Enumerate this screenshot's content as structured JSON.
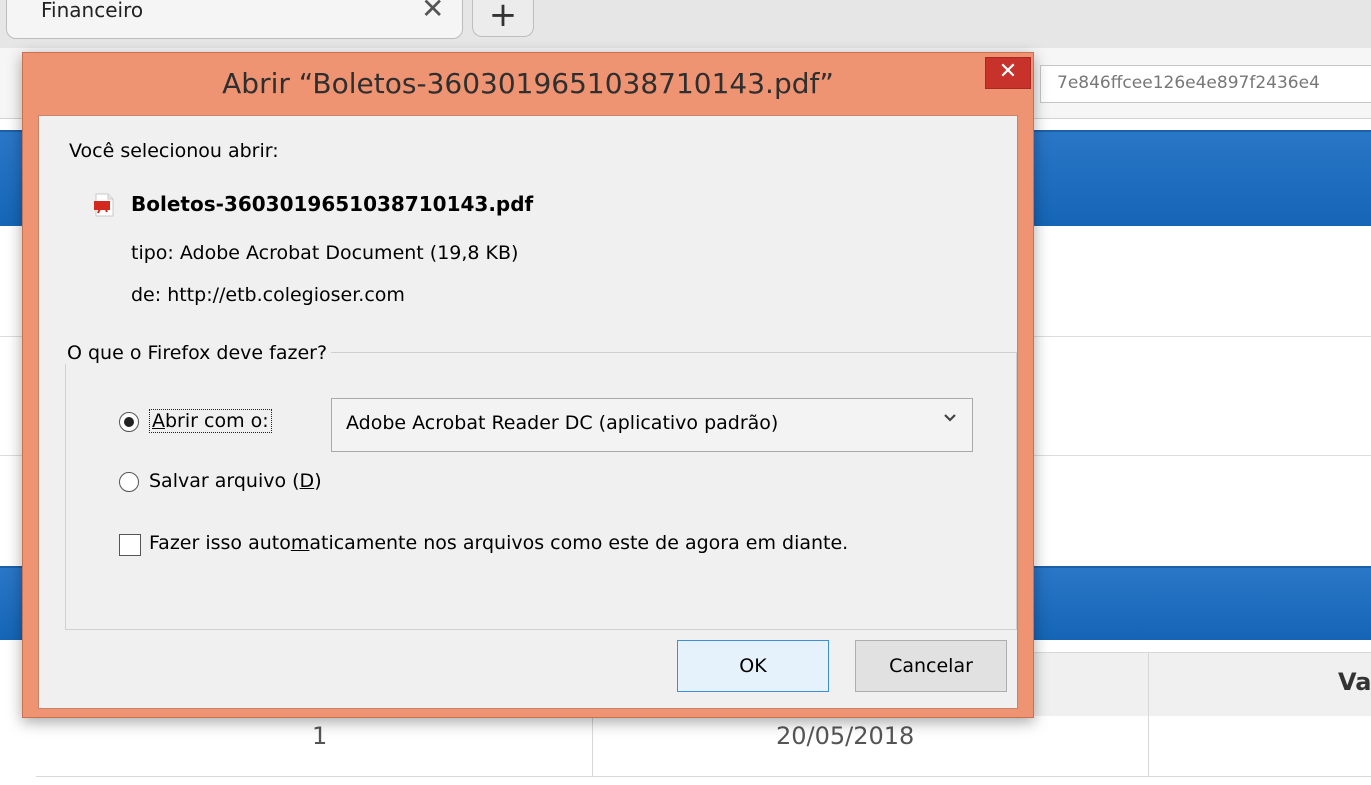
{
  "browser": {
    "tab_title": "Financeiro",
    "tab_close": "✕",
    "new_tab": "+",
    "url_fragment": "7e846ffcee126e4e897f2436e4",
    "table": {
      "header_partial": "Va",
      "row1_col1": "1",
      "row1_col2": "20/05/2018"
    }
  },
  "dialog": {
    "title": "Abrir “Boletos-3603019651038710143.pdf”",
    "close_label": "✕",
    "intro": "Você selecionou abrir:",
    "file_name": "Boletos-3603019651038710143.pdf",
    "type_line": "tipo:  Adobe Acrobat Document (19,8 KB)",
    "from_line": "de:  http://etb.colegioser.com",
    "group_label": "O que o Firefox deve fazer?",
    "open_with_prefix": "A",
    "open_with_rest": "brir com o:",
    "open_with_selected": "Adobe Acrobat Reader DC  (aplicativo padrão)",
    "save_prefix": "Salvar arquivo (",
    "save_key": "D",
    "save_suffix": ")",
    "auto_prefix": "Fazer isso auto",
    "auto_key": "m",
    "auto_suffix": "aticamente nos arquivos como este de agora em diante.",
    "ok_label": "OK",
    "cancel_label": "Cancelar",
    "state": {
      "open_with_checked": true,
      "save_checked": false,
      "auto_checked": false
    },
    "colors": {
      "frame": "#ef9473",
      "close": "#c7322a"
    }
  }
}
